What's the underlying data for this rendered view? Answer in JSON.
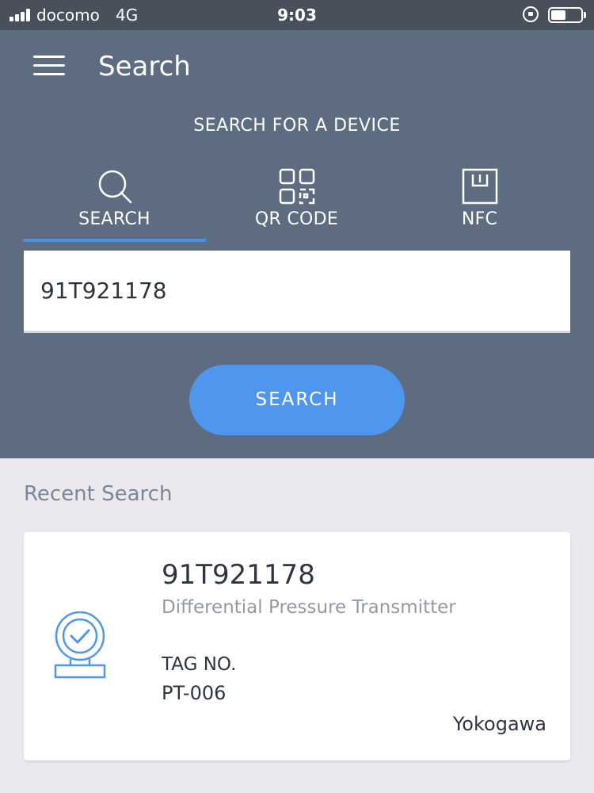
{
  "status_bar": {
    "carrier": "docomo",
    "network": "4G",
    "time": "9:03",
    "battery_level": 0.5
  },
  "header": {
    "title": "Search",
    "menu_icon": "hamburger-menu-icon"
  },
  "search_section": {
    "title": "SEARCH FOR A DEVICE",
    "tabs": [
      {
        "label": "SEARCH",
        "icon": "magnifier-icon",
        "selected": true
      },
      {
        "label": "QR CODE",
        "icon": "qr-code-icon",
        "selected": false
      },
      {
        "label": "NFC",
        "icon": "nfc-icon",
        "selected": false
      }
    ],
    "input_value": "91T921178",
    "button_label": "SEARCH"
  },
  "recent": {
    "heading": "Recent Search",
    "items": [
      {
        "device_id": "91T921178",
        "device_type": "Differential Pressure Transmitter",
        "tag_label": "TAG NO.",
        "tag_value": "PT-006",
        "manufacturer": "Yokogawa",
        "icon": "verified-device-icon"
      }
    ]
  },
  "colors": {
    "header_bg": "#5d6c80",
    "status_bar_bg": "#48505c",
    "accent": "#4f96ef",
    "page_bg": "#ebe9ee"
  }
}
